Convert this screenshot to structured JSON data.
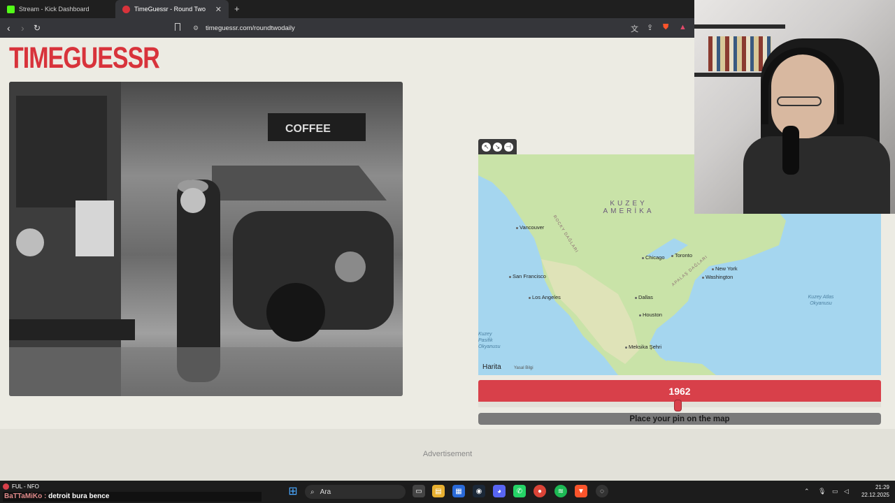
{
  "browser": {
    "tabs": [
      {
        "title": "Stream - Kick Dashboard",
        "active": false,
        "favicon_color": "#53fc18"
      },
      {
        "title": "TimeGuessr - Round Two",
        "active": true,
        "favicon_color": "#d8333b"
      }
    ],
    "url": "timeguessr.com/roundtwodaily"
  },
  "page": {
    "logo": "TIMEGUESSR",
    "map": {
      "region_label_1": "KUZEY",
      "region_label_2": "AMERİKA",
      "cities": [
        "Vancouver",
        "Chicago",
        "Toronto",
        "New York",
        "Washington",
        "San Francisco",
        "Los Angeles",
        "Dallas",
        "Houston",
        "Meksika Şehri"
      ],
      "ocean_atlantic": "Kuzey Atlas Okyanusu",
      "ocean_pacific": "Kuzey Pasifik Okyanusu",
      "range_rocky": "ROCKY DAĞLARI",
      "range_appalachian": "APALAŞ DAĞLARI",
      "provider": "Harita",
      "legal": "Yasal Bilgi"
    },
    "year": "1962",
    "year_slider_fraction": 0.5,
    "submit_label": "Place your pin on the map",
    "advertisement": "Advertisement"
  },
  "stream": {
    "chat_user": "FUL - NFO",
    "chat_name": "BaTTaMiKo :",
    "chat_message": "detroit bura bence"
  },
  "taskbar": {
    "search_placeholder": "Ara",
    "time": "21:29",
    "date": "22.12.2025"
  },
  "colors": {
    "brand_red": "#d8333b",
    "map_water": "#a5d6ef",
    "map_land": "#c9e3a8"
  }
}
